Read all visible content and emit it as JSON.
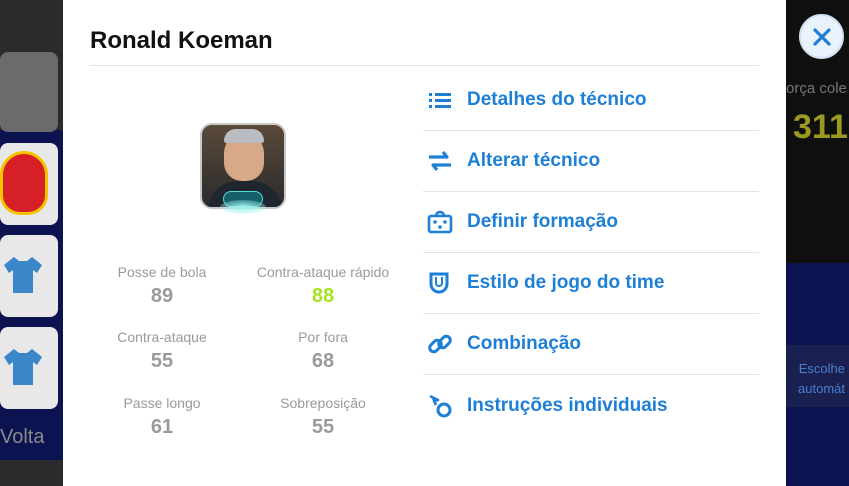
{
  "background": {
    "left_label": "Volta",
    "right_label_top": "orça cole",
    "right_number": "311",
    "right_label_bottom": "Escolhe\nautomát"
  },
  "panel": {
    "title": "Ronald Koeman",
    "stats": [
      {
        "label": "Posse de bola",
        "value": "89"
      },
      {
        "label": "Contra-ataque rápido",
        "value": "88",
        "highlight": true
      },
      {
        "label": "Contra-ataque",
        "value": "55"
      },
      {
        "label": "Por fora",
        "value": "68"
      },
      {
        "label": "Passe longo",
        "value": "61"
      },
      {
        "label": "Sobreposição",
        "value": "55"
      }
    ],
    "menu": [
      {
        "label": "Detalhes do técnico",
        "icon": "list-icon"
      },
      {
        "label": "Alterar técnico",
        "icon": "swap-icon"
      },
      {
        "label": "Definir formação",
        "icon": "formation-icon"
      },
      {
        "label": "Estilo de jogo do time",
        "icon": "shield-icon"
      },
      {
        "label": "Combinação",
        "icon": "link-icon"
      },
      {
        "label": "Instruções individuais",
        "icon": "player-instructions-icon"
      }
    ]
  },
  "colors": {
    "accent": "#1e7fd6",
    "highlight": "#a6e21f",
    "muted": "#9a9a9a"
  }
}
